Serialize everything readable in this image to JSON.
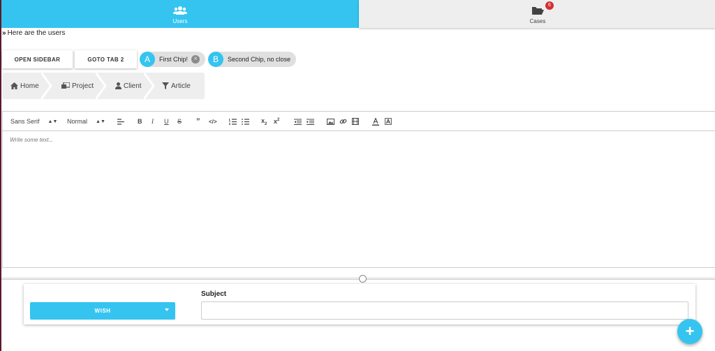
{
  "tabs": [
    {
      "label": "Users",
      "icon": "users-icon",
      "active": true
    },
    {
      "label": "Cases",
      "icon": "folder-open-icon",
      "badge": "6",
      "active": false
    }
  ],
  "users_text": "Here are the users",
  "buttons": {
    "open_sidebar": "OPEN SIDEBAR",
    "goto_tab2": "GOTO TAB 2"
  },
  "chips": [
    {
      "avatar": "A",
      "label": "First Chip!",
      "closable": true
    },
    {
      "avatar": "B",
      "label": "Second Chip, no close",
      "closable": false
    }
  ],
  "breadcrumb": [
    {
      "label": "Home",
      "icon": "home-icon"
    },
    {
      "label": "Project",
      "icon": "project-icon"
    },
    {
      "label": "Client",
      "icon": "user-icon"
    },
    {
      "label": "Article",
      "icon": "filter-icon"
    }
  ],
  "editor": {
    "font": "Sans Serif",
    "size": "Normal",
    "placeholder": "Write some text..."
  },
  "form": {
    "wish_label": "WISH",
    "subject_label": "Subject",
    "subject_value": ""
  },
  "fab_label": "+",
  "colors": {
    "accent": "#35c4f0",
    "badge": "#d32f2f",
    "chip_bg": "#e0e0e0"
  }
}
